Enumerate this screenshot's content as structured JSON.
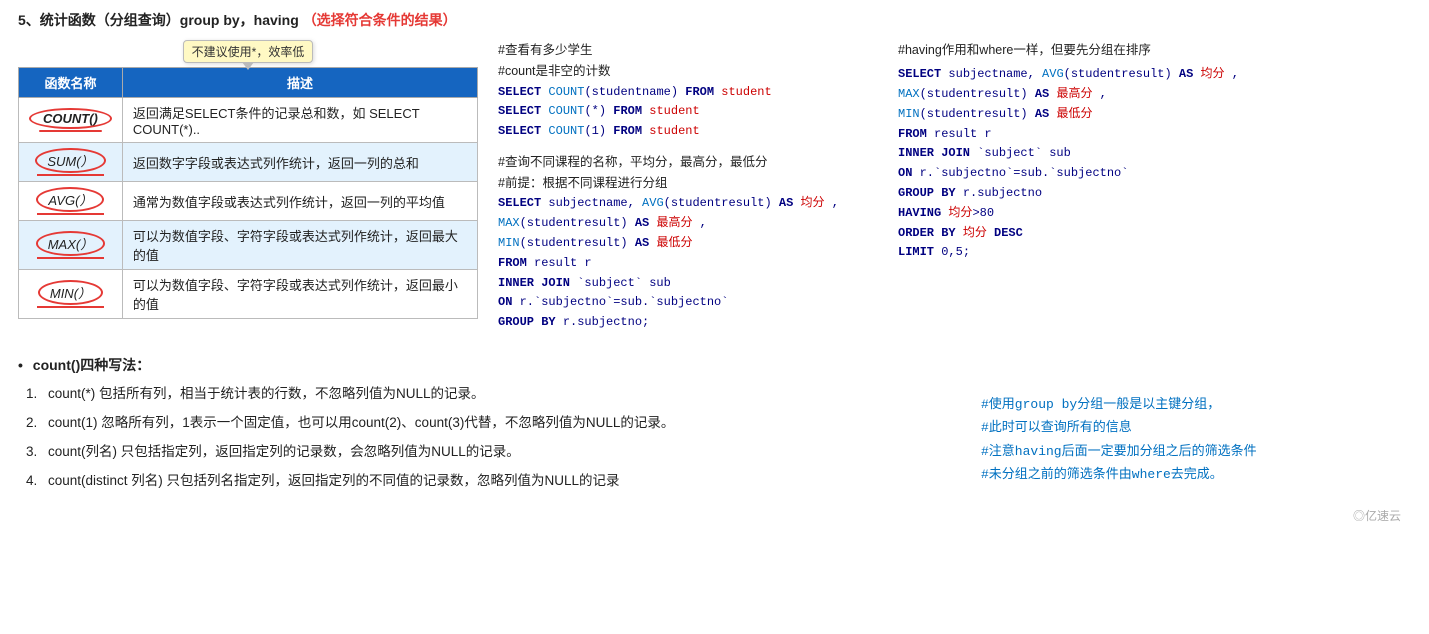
{
  "page": {
    "title": "5、统计函数（分组查询）group by，having",
    "title_highlight": "（选择符合条件的结果）",
    "tooltip": {
      "text": "不建议使用*，效率低"
    },
    "table": {
      "headers": [
        "函数名称",
        "描述"
      ],
      "rows": [
        {
          "name": "COUNT()",
          "desc": "返回满足SELECT条件的记录总和数，如 SELECT COUNT(*).."
        },
        {
          "name": "SUM(）",
          "desc": "返回数字字段或表达式列作统计，返回一列的总和"
        },
        {
          "name": "AVG(）",
          "desc": "通常为数值字段或表达式列作统计，返回一列的平均值"
        },
        {
          "name": "MAX(）",
          "desc": "可以为数值字段、字符字段或表达式列作统计，返回最大的值"
        },
        {
          "name": "MIN(）",
          "desc": "可以为数值字段、字符字段或表达式列作统计，返回最小的值"
        }
      ]
    },
    "sql_block1": {
      "comment1": "#查看有多少学生",
      "comment2": "#count是非空的计数",
      "line1": "SELECT COUNT(studentname) FROM student",
      "line2": "SELECT COUNT(*) FROM student",
      "line3": "SELECT COUNT(1) FROM student"
    },
    "sql_block2": {
      "comment1": "#查询不同课程的名称，平均分，最高分，最低分",
      "comment2": "#前提：根据不同课程进行分组",
      "line1": "SELECT subjectname, AVG(studentresult) AS 均分 ,",
      "line2": "MAX(studentresult) AS 最高分 ,",
      "line3": "MIN(studentresult) AS 最低分",
      "line4": "FROM result r",
      "line5": "INNER JOIN `subject` sub",
      "line6": "ON r.`subjectno`=sub.`subjectno`",
      "line7": "GROUP BY r.subjectno;"
    },
    "having_block": {
      "comment": "#having作用和where一样，但要先分组在排序",
      "line1": "SELECT subjectname, AVG(studentresult) AS 均分 ,",
      "line2": "MAX(studentresult) AS 最高分 ,",
      "line3": "MIN(studentresult) AS 最低分",
      "line4": "FROM result r",
      "line5": "INNER JOIN `subject` sub",
      "line6": "ON r.`subjectno`=sub.`subjectno`",
      "line7": "GROUP BY r.subjectno",
      "line8": "HAVING 均分>80",
      "line9": "ORDER BY 均分 DESC",
      "line10": "LIMIT 0,5;"
    },
    "bullet_title": "count()四种写法：",
    "numbered_items": [
      {
        "num": "1.",
        "text": "count(*) 包括所有列，相当于统计表的行数，不忽略列值为NULL的记录。"
      },
      {
        "num": "2.",
        "text": "count(1) 忽略所有列，1表示一个固定值，也可以用count(2)、count(3)代替，不忽略列值为NULL的记录。"
      },
      {
        "num": "3.",
        "text": "count(列名) 只包括指定列，返回指定列的记录数，会忽略列值为NULL的记录。"
      },
      {
        "num": "4.",
        "text": "count(distinct 列名) 只包括列名指定列，返回指定列的不同值的记录数，忽略列值为NULL的记录"
      }
    ],
    "bottom_right_note": {
      "line1": "#使用group by分组一般是以主键分组，",
      "line2": "#此时可以查询所有的信息",
      "line3": "#注意having后面一定要加分组之后的筛选条件",
      "line4": "#未分组之前的筛选条件由where去完成。"
    },
    "watermark": "◎亿速云"
  }
}
